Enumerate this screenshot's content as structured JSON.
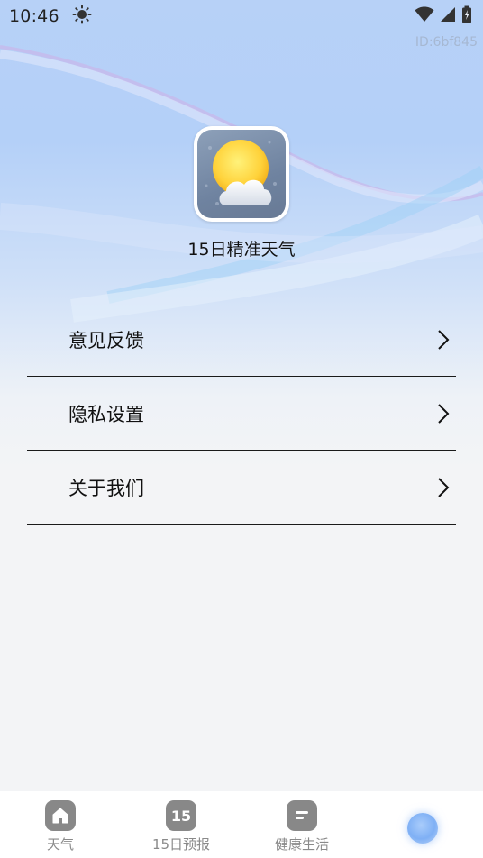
{
  "status_bar": {
    "time": "10:46",
    "icons": [
      "brightness-icon",
      "wifi-icon",
      "cellular-signal-icon",
      "battery-icon"
    ]
  },
  "device_id": "ID:6bf845",
  "app": {
    "name": "15日精准天气",
    "icon": "sun-cloud-icon"
  },
  "menu": {
    "items": [
      {
        "label": "意见反馈",
        "icon": "chevron-right-icon"
      },
      {
        "label": "隐私设置",
        "icon": "chevron-right-icon"
      },
      {
        "label": "关于我们",
        "icon": "chevron-right-icon"
      }
    ]
  },
  "tabbar": {
    "items": [
      {
        "label": "天气",
        "icon": "home-icon"
      },
      {
        "label": "15日预报",
        "icon_text": "15",
        "icon": "calendar-15-icon"
      },
      {
        "label": "健康生活",
        "icon": "note-icon"
      },
      {
        "label": "",
        "icon": "orb-icon"
      }
    ]
  },
  "colors": {
    "background_top": "#b7d1f7",
    "background_bottom": "#f3f4f6",
    "tab_icon": "#888888",
    "tab_label": "#8a8a8a",
    "divider": "#1a1a1a"
  }
}
